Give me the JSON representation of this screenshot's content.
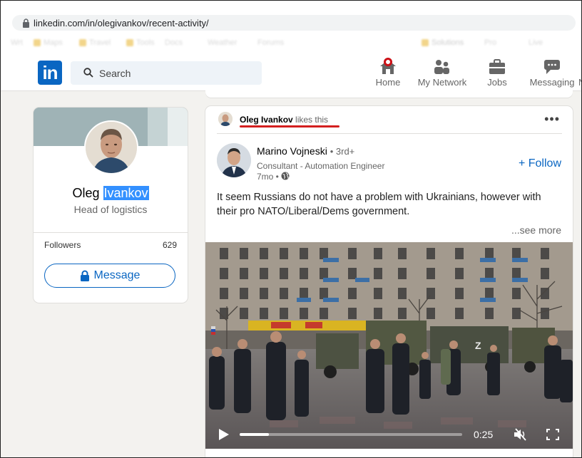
{
  "browser": {
    "url": "linkedin.com/in/olegivankov/recent-activity/",
    "bookmarks": [
      "Wrt",
      "Maps",
      "Travel",
      "Tools",
      "Docs",
      "",
      "Weather",
      "Forums",
      "Solutions",
      "Pro",
      "Live"
    ]
  },
  "nav": {
    "logo": "in",
    "search_placeholder": "Search",
    "items": [
      {
        "label": "Home",
        "icon": "home-icon"
      },
      {
        "label": "My Network",
        "icon": "network-icon"
      },
      {
        "label": "Jobs",
        "icon": "jobs-icon"
      },
      {
        "label": "Messaging",
        "icon": "messaging-icon"
      },
      {
        "label": "N",
        "icon": "notifications-icon"
      }
    ]
  },
  "profile": {
    "first_name": "Oleg",
    "last_name": "Ivankov",
    "headline": "Head of logistics",
    "followers_label": "Followers",
    "followers_count": "629",
    "message_label": "Message"
  },
  "post": {
    "liker_name": "Oleg Ivankov",
    "likes_text": "likes this",
    "author_name": "Marino Vojneski",
    "author_degree": "• 3rd+",
    "author_headline": "Consultant - Automation Engineer",
    "post_age": "7mo •",
    "follow_label": "+ Follow",
    "text": "It seem Russians do not have a problem with Ukrainians, however with their pro NATO/Liberal/Dems government.",
    "see_more": "...see more",
    "video_time": "0:25",
    "video_progress": 0.13,
    "colors": {
      "accent": "#0a66c2",
      "highlight": "#d31f1f"
    }
  }
}
